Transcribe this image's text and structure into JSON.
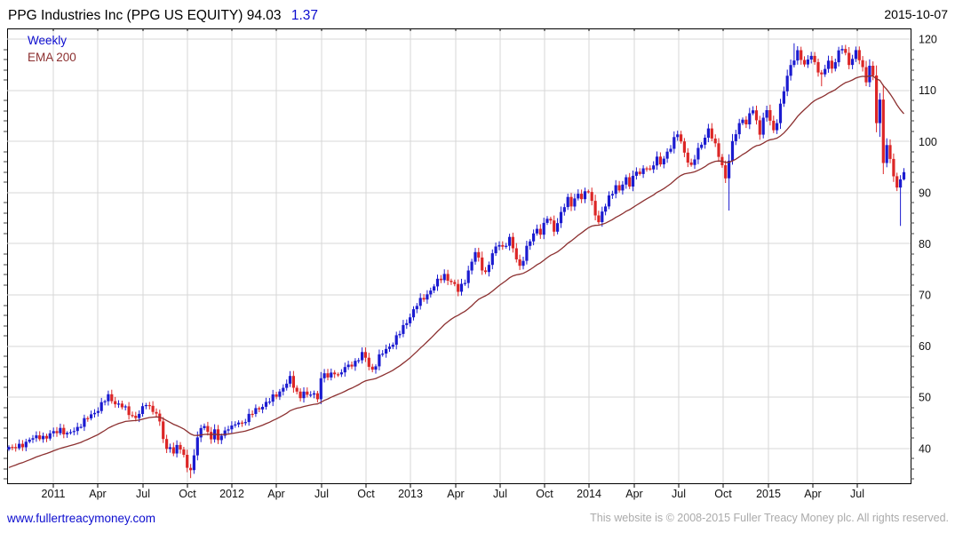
{
  "header": {
    "title": "PPG Industries Inc (PPG US EQUITY) 94.03",
    "change": "1.37",
    "date": "2015-10-07"
  },
  "legend": {
    "series_label": "Weekly",
    "overlay_label": "EMA 200"
  },
  "footer": {
    "link": "www.fullertreacymoney.com",
    "copyright": "This website is © 2008-2015 Fuller Treacy Money plc. All rights reserved."
  },
  "colors": {
    "up_candle": "#1b1bd0",
    "down_candle": "#dc2626",
    "ema_line": "#8c3030",
    "grid": "#d7d7d7",
    "axis": "#000000",
    "minor_tick": "#444444",
    "title_text": "#000000",
    "change_text": "#0d0dcf",
    "link_text": "#0d0dcf",
    "copyright_text": "#aaaaaa",
    "label_text": "#111111"
  },
  "chart_data": {
    "type": "candlestick",
    "instrument": "PPG Industries Inc (PPG US EQUITY)",
    "timeframe": "weekly",
    "last_price": 94.03,
    "change": 1.37,
    "as_of_date": "2015-10-07",
    "weeks": 262,
    "ylim": [
      33.2,
      122.1
    ],
    "y_ticks": [
      40,
      50,
      60,
      70,
      80,
      90,
      100,
      110,
      120
    ],
    "x_ticks": [
      {
        "label": "2011",
        "week": 12.9
      },
      {
        "label": "Apr",
        "week": 25.9
      },
      {
        "label": "Jul",
        "week": 39.0
      },
      {
        "label": "Oct",
        "week": 52.0
      },
      {
        "label": "2012",
        "week": 65.0
      },
      {
        "label": "Apr",
        "week": 78.1
      },
      {
        "label": "Jul",
        "week": 91.1
      },
      {
        "label": "Oct",
        "week": 104.1
      },
      {
        "label": "2013",
        "week": 117.2
      },
      {
        "label": "Apr",
        "week": 130.2
      },
      {
        "label": "Jul",
        "week": 143.2
      },
      {
        "label": "Oct",
        "week": 156.3
      },
      {
        "label": "2014",
        "week": 169.3
      },
      {
        "label": "Apr",
        "week": 182.3
      },
      {
        "label": "Jul",
        "week": 195.4
      },
      {
        "label": "Oct",
        "week": 208.4
      },
      {
        "label": "2015",
        "week": 221.4
      },
      {
        "label": "Apr",
        "week": 234.5
      },
      {
        "label": "Jul",
        "week": 247.5
      }
    ],
    "overlay": {
      "name": "EMA 200",
      "period_weeks": 30,
      "seed": 36.0
    },
    "close_anchors": [
      [
        0,
        40.3
      ],
      [
        1,
        39.8
      ],
      [
        3,
        40.6
      ],
      [
        5,
        41.2
      ],
      [
        7,
        41.9
      ],
      [
        9,
        42.5
      ],
      [
        11,
        42.1
      ],
      [
        13,
        43.1
      ],
      [
        15,
        43.9
      ],
      [
        17,
        42.5
      ],
      [
        19,
        43.6
      ],
      [
        21,
        44.8
      ],
      [
        23,
        45.9
      ],
      [
        25,
        47.1
      ],
      [
        27,
        48.6
      ],
      [
        29,
        50.1
      ],
      [
        31,
        49.0
      ],
      [
        33,
        48.2
      ],
      [
        35,
        46.9
      ],
      [
        37,
        46.1
      ],
      [
        39,
        47.6
      ],
      [
        40,
        48.8
      ],
      [
        42,
        47.6
      ],
      [
        43,
        46.8
      ],
      [
        44,
        44.8
      ],
      [
        45,
        42.0
      ],
      [
        46,
        39.6
      ],
      [
        47,
        40.9
      ],
      [
        48,
        38.9
      ],
      [
        49,
        40.5
      ],
      [
        50,
        39.7
      ],
      [
        51,
        38.4
      ],
      [
        52,
        36.9
      ],
      [
        53,
        35.6
      ],
      [
        54,
        38.8
      ],
      [
        55,
        41.8
      ],
      [
        56,
        43.7
      ],
      [
        57,
        44.9
      ],
      [
        58,
        43.1
      ],
      [
        59,
        42.2
      ],
      [
        60,
        43.2
      ],
      [
        61,
        41.5
      ],
      [
        62,
        42.7
      ],
      [
        63,
        43.5
      ],
      [
        64,
        44.3
      ],
      [
        65,
        43.9
      ],
      [
        66,
        44.7
      ],
      [
        68,
        45.1
      ],
      [
        70,
        46.3
      ],
      [
        72,
        47.4
      ],
      [
        74,
        48.5
      ],
      [
        76,
        49.3
      ],
      [
        78,
        50.5
      ],
      [
        80,
        52.0
      ],
      [
        82,
        53.5
      ],
      [
        83,
        52.2
      ],
      [
        84,
        51.0
      ],
      [
        85,
        50.3
      ],
      [
        86,
        51.1
      ],
      [
        87,
        50.0
      ],
      [
        88,
        50.7
      ],
      [
        90,
        50.3
      ],
      [
        91,
        53.6
      ],
      [
        92,
        54.5
      ],
      [
        93,
        53.8
      ],
      [
        95,
        55.2
      ],
      [
        96,
        54.3
      ],
      [
        97,
        55.0
      ],
      [
        99,
        56.1
      ],
      [
        101,
        57.0
      ],
      [
        103,
        58.3
      ],
      [
        104,
        57.6
      ],
      [
        105,
        56.2
      ],
      [
        106,
        55.4
      ],
      [
        107,
        56.6
      ],
      [
        108,
        57.8
      ],
      [
        110,
        59.3
      ],
      [
        112,
        60.8
      ],
      [
        114,
        62.5
      ],
      [
        116,
        64.8
      ],
      [
        117,
        66.0
      ],
      [
        119,
        68.0
      ],
      [
        121,
        69.5
      ],
      [
        123,
        71.0
      ],
      [
        125,
        72.5
      ],
      [
        127,
        74.0
      ],
      [
        129,
        72.5
      ],
      [
        131,
        70.8
      ],
      [
        133,
        73.0
      ],
      [
        135,
        76.3
      ],
      [
        136,
        78.3
      ],
      [
        137,
        77.0
      ],
      [
        138,
        75.5
      ],
      [
        139,
        74.3
      ],
      [
        140,
        76.0
      ],
      [
        141,
        77.8
      ],
      [
        142,
        79.2
      ],
      [
        143,
        80.3
      ],
      [
        144,
        79.3
      ],
      [
        145,
        80.0
      ],
      [
        146,
        80.8
      ],
      [
        147,
        79.0
      ],
      [
        148,
        77.2
      ],
      [
        149,
        75.7
      ],
      [
        150,
        77.2
      ],
      [
        151,
        79.0
      ],
      [
        152,
        80.5
      ],
      [
        153,
        81.9
      ],
      [
        154,
        83.1
      ],
      [
        155,
        82.3
      ],
      [
        156,
        83.6
      ],
      [
        157,
        85.0
      ],
      [
        158,
        84.1
      ],
      [
        159,
        82.7
      ],
      [
        160,
        84.4
      ],
      [
        161,
        86.0
      ],
      [
        162,
        87.3
      ],
      [
        163,
        88.5
      ],
      [
        164,
        87.7
      ],
      [
        165,
        89.0
      ],
      [
        166,
        89.9
      ],
      [
        167,
        88.8
      ],
      [
        168,
        89.6
      ],
      [
        169,
        90.5
      ],
      [
        170,
        88.3
      ],
      [
        171,
        86.0
      ],
      [
        172,
        84.2
      ],
      [
        173,
        85.8
      ],
      [
        174,
        87.5
      ],
      [
        175,
        89.2
      ],
      [
        176,
        90.4
      ],
      [
        177,
        91.3
      ],
      [
        178,
        90.2
      ],
      [
        179,
        91.5
      ],
      [
        180,
        92.7
      ],
      [
        181,
        91.9
      ],
      [
        182,
        93.1
      ],
      [
        183,
        94.2
      ],
      [
        184,
        93.3
      ],
      [
        185,
        94.5
      ],
      [
        186,
        95.3
      ],
      [
        187,
        94.4
      ],
      [
        188,
        95.7
      ],
      [
        189,
        96.5
      ],
      [
        190,
        95.4
      ],
      [
        191,
        96.9
      ],
      [
        193,
        99.1
      ],
      [
        195,
        101.4
      ],
      [
        196,
        99.9
      ],
      [
        197,
        98.0
      ],
      [
        198,
        96.4
      ],
      [
        199,
        94.9
      ],
      [
        200,
        96.6
      ],
      [
        201,
        98.3
      ],
      [
        202,
        99.7
      ],
      [
        203,
        101.1
      ],
      [
        204,
        102.3
      ],
      [
        205,
        100.7
      ],
      [
        206,
        99.0
      ],
      [
        207,
        97.4
      ],
      [
        208,
        95.5
      ],
      [
        209,
        92.9
      ],
      [
        210,
        96.3
      ],
      [
        211,
        99.4
      ],
      [
        212,
        101.8
      ],
      [
        213,
        103.5
      ],
      [
        214,
        104.7
      ],
      [
        215,
        103.3
      ],
      [
        216,
        105.0
      ],
      [
        217,
        106.3
      ],
      [
        218,
        103.9
      ],
      [
        219,
        102.0
      ],
      [
        220,
        104.5
      ],
      [
        221,
        105.9
      ],
      [
        222,
        104.0
      ],
      [
        223,
        101.9
      ],
      [
        224,
        104.3
      ],
      [
        225,
        107.2
      ],
      [
        226,
        109.9
      ],
      [
        227,
        112.5
      ],
      [
        228,
        114.7
      ],
      [
        229,
        116.4
      ],
      [
        230,
        117.7
      ],
      [
        231,
        116.3
      ],
      [
        232,
        114.5
      ],
      [
        233,
        115.9
      ],
      [
        234,
        117.0
      ],
      [
        235,
        115.5
      ],
      [
        236,
        114.0
      ],
      [
        237,
        112.5
      ],
      [
        238,
        114.2
      ],
      [
        239,
        115.7
      ],
      [
        240,
        114.4
      ],
      [
        241,
        116.0
      ],
      [
        242,
        117.3
      ],
      [
        243,
        118.2
      ],
      [
        244,
        116.9
      ],
      [
        245,
        115.3
      ],
      [
        246,
        116.5
      ],
      [
        247,
        117.6
      ],
      [
        248,
        116.0
      ],
      [
        249,
        113.9
      ],
      [
        250,
        112.0
      ],
      [
        251,
        114.8
      ],
      [
        252,
        112.9
      ],
      [
        253,
        103.6
      ],
      [
        254,
        108.2
      ],
      [
        255,
        95.8
      ],
      [
        256,
        99.3
      ],
      [
        257,
        96.6
      ],
      [
        258,
        93.2
      ],
      [
        259,
        91.0
      ],
      [
        260,
        92.6
      ],
      [
        261,
        94.0
      ]
    ],
    "wick_overrides": {
      "53": {
        "low": 34.2
      },
      "210": {
        "low": 86.5
      },
      "229": {
        "high": 119.2
      },
      "237": {
        "low": 110.8
      },
      "243": {
        "high": 118.8
      },
      "253": {
        "low": 101.8
      },
      "254": {
        "low": 100.9
      },
      "260": {
        "low": 83.5
      },
      "261": {
        "low": 92.4,
        "high": 94.8
      }
    }
  }
}
